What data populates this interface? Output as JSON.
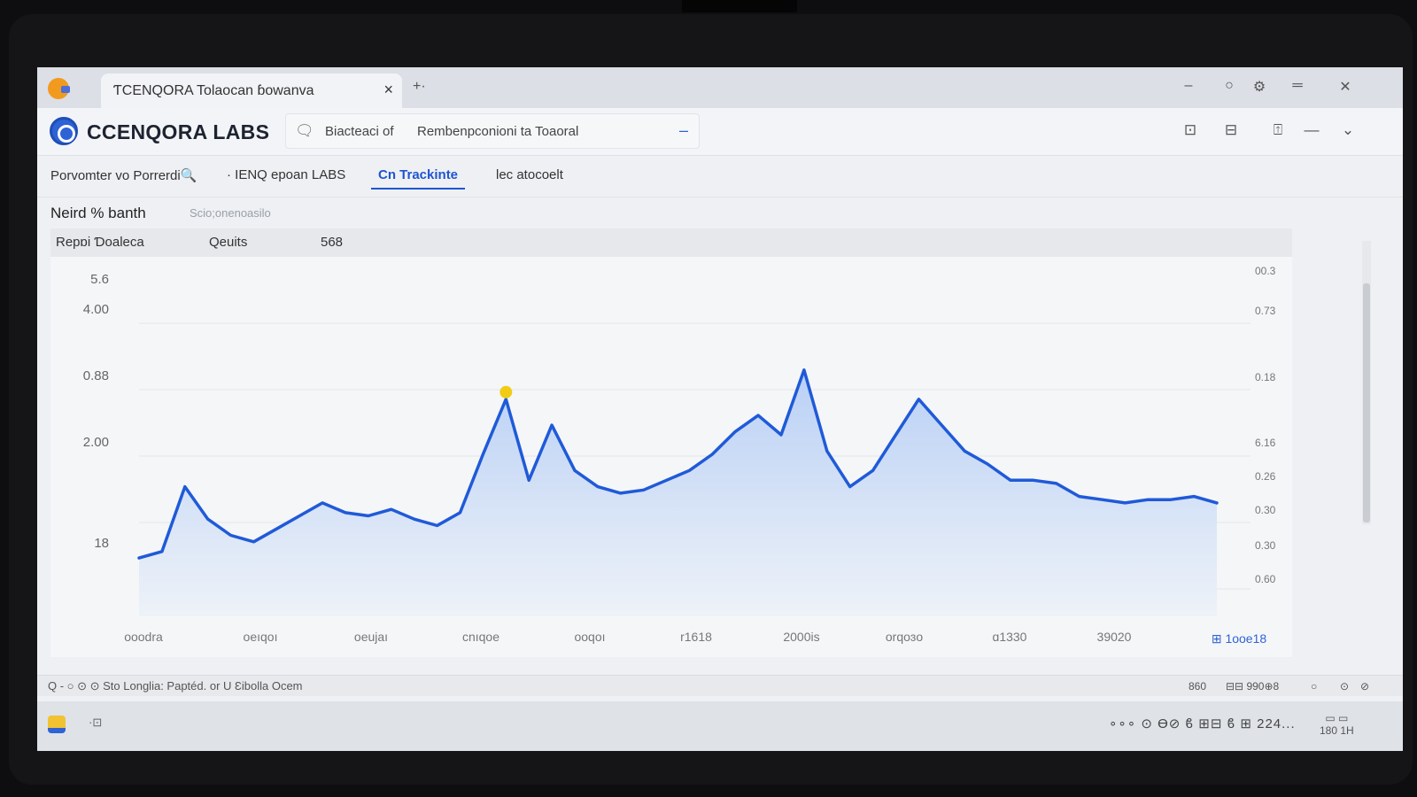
{
  "window": {
    "tab_title": "ƬCENQORA  Tolaocan ɓowanva",
    "tab_close": "×",
    "new_tab": "+·",
    "controls": [
      "–",
      "○",
      "⚙",
      "═",
      "✕"
    ]
  },
  "header": {
    "brand": "CCENQORA LABS",
    "search_scope": "Biacteaci of",
    "search_value": "Rembenpconioni ta Toaoral",
    "search_min": "–"
  },
  "nav_tabs": [
    {
      "label": "Porvomter vo Porrerdi🔍"
    },
    {
      "label": "· IENQ epoan LABS"
    },
    {
      "label": "Cn Trackinte"
    },
    {
      "label": "Ɩec atocoelt"
    }
  ],
  "section": {
    "title": "Neird % banth",
    "subtitle": "Scio;onenoasilo"
  },
  "summary": {
    "label": "Repɒi Ɗoaleca",
    "key": "Qeuits",
    "value": "568"
  },
  "chart_data": {
    "type": "area",
    "y_ticks_left": [
      "5.6",
      "4.00",
      "0.88",
      "2.00",
      "18"
    ],
    "y_ticks_right": [
      "00.3",
      "0.73",
      "0.18",
      "6.16",
      "0.26",
      "0.30",
      "0.30",
      "0.60"
    ],
    "x_ticks": [
      "ooodra",
      "oeıqoı",
      "oeujaı",
      "cnıqoe",
      "ooqoı",
      "r1618",
      "2000is",
      "orqoɜo",
      "ɑ1330",
      "39020"
    ],
    "x_tick_extra": "⊞ 1ooe18",
    "y_range": [
      0,
      100
    ],
    "values": [
      18,
      20,
      40,
      30,
      25,
      23,
      27,
      31,
      35,
      32,
      31,
      33,
      30,
      28,
      32,
      50,
      67,
      42,
      59,
      45,
      40,
      38,
      39,
      42,
      45,
      50,
      57,
      62,
      56,
      76,
      51,
      40,
      45,
      56,
      67,
      59,
      51,
      47,
      42,
      42,
      41,
      37,
      36,
      35,
      36,
      36,
      37,
      35
    ],
    "highlight_index": 16,
    "line_color": "#1f5ad8",
    "fill_color_top": "#b9d0f5",
    "fill_color_bottom": "#eef2f8",
    "marker_color": "#f2cc14",
    "grid": true
  },
  "statusbar": {
    "text": "Q  -  ○   ⊙ ⊙ Sto Longlia: Paptéd. or U Ɛibolla Ocem",
    "right": [
      "860",
      "⊟⊟ 990⊕8",
      "○",
      "⊙",
      "⊘"
    ]
  },
  "taskbar": {
    "app_icon": "·⊡",
    "tray": "∘∘∘ ⊙ Ɵ⊘  ϐ  ⊞⊟  ϐ ⊞  224...",
    "clock_time": "▭ ▭",
    "clock_date": "180 1H"
  }
}
